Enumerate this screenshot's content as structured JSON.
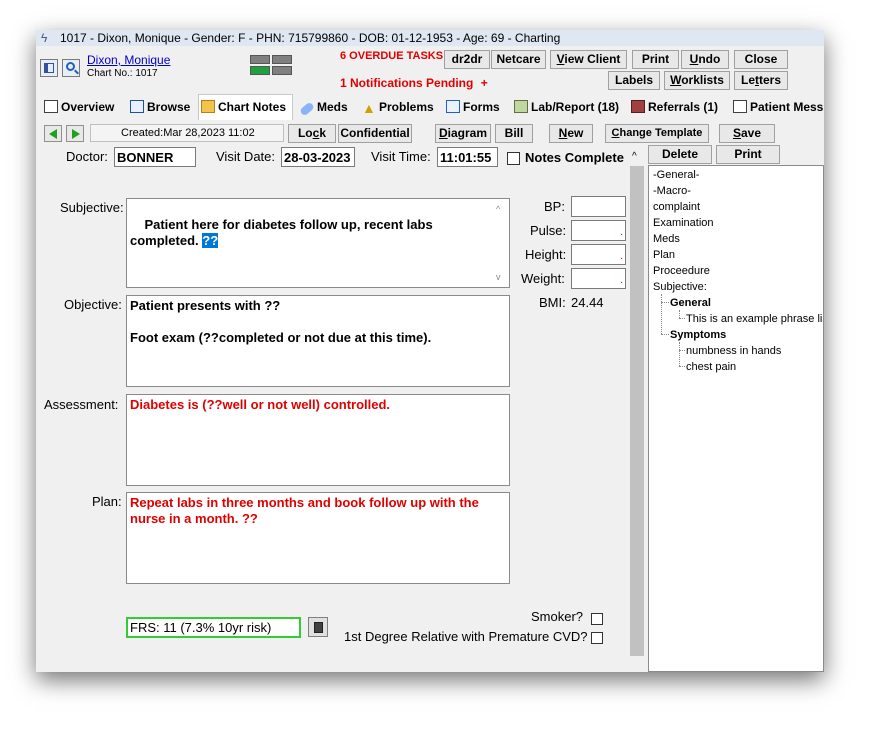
{
  "titlebar": {
    "text": "1017 - Dixon, Monique - Gender: F - PHN: 715799860 - DOB: 01-12-1953 - Age: 69 - Charting"
  },
  "patient": {
    "name": "Dixon, Monique",
    "chart_no": "Chart No.: 1017"
  },
  "alerts": {
    "overdue": "6 OVERDUE TASKS",
    "notifications": "1 Notifications Pending",
    "plus": "+"
  },
  "toolbar1": {
    "dr2dr": "dr2dr",
    "netcare": "Netcare",
    "view_client": "View Client",
    "print": "Print",
    "undo": "Undo",
    "close": "Close"
  },
  "toolbar2": {
    "labels": "Labels",
    "worklists": "Worklists",
    "letters": "Letters"
  },
  "tabs": [
    {
      "label": "Overview",
      "icon": "overview-icon"
    },
    {
      "label": "Browse",
      "icon": "browse-icon"
    },
    {
      "label": "Chart Notes",
      "icon": "folder-icon"
    },
    {
      "label": "Meds",
      "icon": "pill-icon"
    },
    {
      "label": "Problems",
      "icon": "warning-icon"
    },
    {
      "label": "Forms",
      "icon": "form-icon"
    },
    {
      "label": "Lab/Report (18)",
      "icon": "lab-icon"
    },
    {
      "label": "Referrals (1)",
      "icon": "referral-icon"
    },
    {
      "label": "Patient Mess",
      "icon": "person-icon"
    }
  ],
  "notebar": {
    "created": "Created:Mar 28,2023 11:02",
    "lock": "Lock",
    "confidential": "Confidential",
    "diagram": "Diagram",
    "bill": "Bill",
    "new": "New",
    "change_template": "Change Template",
    "save": "Save"
  },
  "tree_toolbar": {
    "delete": "Delete",
    "print": "Print"
  },
  "visit": {
    "doctor_label": "Doctor:",
    "doctor": "BONNER",
    "date_label": "Visit Date:",
    "date": "28-03-2023",
    "time_label": "Visit Time:",
    "time": "11:01:55",
    "notes_complete": "Notes Complete"
  },
  "soap": {
    "subjective_label": "Subjective:",
    "subjective": "Patient here for diabetes follow up, recent labs completed. ",
    "subjective_sel": "??",
    "objective_label": "Objective:",
    "objective": "Patient presents with ??\n\nFoot exam (??completed or not due at this time).",
    "assessment_label": "Assessment:",
    "assessment": "Diabetes is (??well or not well) controlled.",
    "plan_label": "Plan:",
    "plan": "Repeat labs in three months and book follow up with the nurse in a month. ??"
  },
  "vitals": {
    "bp": "BP:",
    "pulse": "Pulse:",
    "height": "Height:",
    "weight": "Weight:",
    "bmi_label": "BMI:",
    "bmi": "24.44"
  },
  "frs": {
    "value": "FRS: 11 (7.3% 10yr risk)"
  },
  "risk": {
    "smoker": "Smoker?",
    "relative": "1st Degree Relative with Premature CVD?"
  },
  "tree": {
    "general": "-General-",
    "macro": "-Macro-",
    "complaint": "complaint",
    "examination": "Examination",
    "meds": "Meds",
    "plan": "Plan",
    "proceedure": "Proceedure",
    "subjective": "Subjective:",
    "general_folder": "General",
    "general_item": "This is an example phrase lis",
    "symptoms": "Symptoms",
    "sym1": "numbness in hands",
    "sym2": "chest pain"
  },
  "colors": {
    "alert_red": "#e00000",
    "link_blue": "#0000cc",
    "frs_border": "#33cc33",
    "selection": "#0078d7"
  }
}
